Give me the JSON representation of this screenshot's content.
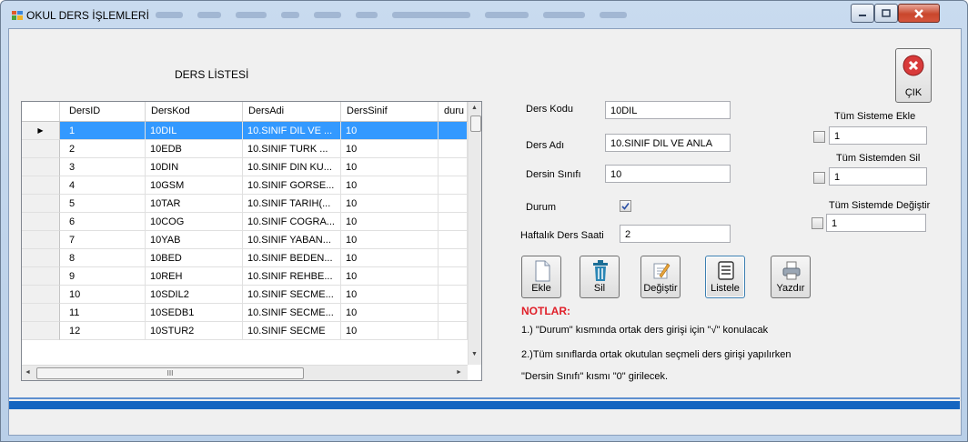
{
  "window": {
    "title": "OKUL DERS İŞLEMLERİ"
  },
  "grid": {
    "title": "DERS LİSTESİ",
    "columns": [
      "DersID",
      "DersKod",
      "DersAdi",
      "DersSinif",
      "duru"
    ],
    "rows": [
      [
        "1",
        "10DIL",
        "10.SINIF DIL VE ...",
        "10"
      ],
      [
        "2",
        "10EDB",
        "10.SINIF TURK ...",
        "10"
      ],
      [
        "3",
        "10DIN",
        "10.SINIF DIN KU...",
        "10"
      ],
      [
        "4",
        "10GSM",
        "10.SINIF GORSE...",
        "10"
      ],
      [
        "5",
        "10TAR",
        "10.SINIF TARIH(...",
        "10"
      ],
      [
        "6",
        "10COG",
        "10.SINIF COGRA...",
        "10"
      ],
      [
        "7",
        "10YAB",
        "10.SINIF YABAN...",
        "10"
      ],
      [
        "8",
        "10BED",
        "10.SINIF BEDEN...",
        "10"
      ],
      [
        "9",
        "10REH",
        "10.SINIF REHBE...",
        "10"
      ],
      [
        "10",
        "10SDIL2",
        "10.SINIF SECME...",
        "10"
      ],
      [
        "11",
        "10SEDB1",
        "10.SINIF SECME...",
        "10"
      ],
      [
        "12",
        "10STUR2",
        "10.SINIF SECME",
        "10"
      ]
    ],
    "hscroll_grip": "III"
  },
  "form": {
    "ders_kodu_label": "Ders Kodu",
    "ders_kodu_value": "10DIL",
    "ders_adi_label": "Ders Adı",
    "ders_adi_value": "10.SINIF DIL VE ANLA",
    "dersin_sinifi_label": "Dersin Sınıfı",
    "dersin_sinifi_value": "10",
    "durum_label": "Durum",
    "durum_checked": true,
    "haftalik_label": "Haftalık Ders Saati",
    "haftalik_value": "2"
  },
  "buttons": {
    "ekle": "Ekle",
    "sil": "Sil",
    "degistir": "Değiştir",
    "listele": "Listele",
    "yazdir": "Yazdır",
    "cik": "ÇIK"
  },
  "system": {
    "ekle_label": "Tüm Sisteme Ekle",
    "ekle_value": "1",
    "sil_label": "Tüm Sistemden Sil",
    "sil_value": "1",
    "degistir_label": "Tüm Sistemde Değiştir",
    "degistir_value": "1"
  },
  "notes": {
    "title": "NOTLAR:",
    "line1": "1.) \"Durum\" kısmında ortak ders girişi için \"√\" konulacak",
    "line2": "2.)Tüm sınıflarda ortak okutulan seçmeli ders girişi yapılırken",
    "line3": "\"Dersin Sınıfı\"  kısmı \"0\" girilecek."
  },
  "colors": {
    "selection": "#3399ff",
    "notes_title": "#e0202a",
    "status_bar": "#1565c0"
  }
}
